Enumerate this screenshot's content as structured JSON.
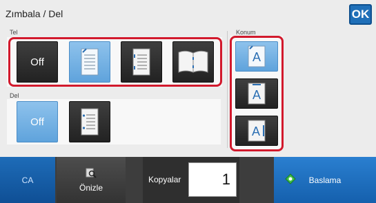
{
  "header": {
    "title": "Zımbala / Del",
    "ok_label": "OK"
  },
  "tel": {
    "label": "Tel",
    "options": [
      {
        "label": "Off",
        "selected": false
      },
      {
        "icon": "staple-one-corner-icon",
        "selected": true
      },
      {
        "icon": "staple-two-left-icon",
        "selected": false
      },
      {
        "icon": "staple-saddle-icon",
        "selected": false
      }
    ]
  },
  "del": {
    "label": "Del",
    "options": [
      {
        "label": "Off",
        "selected": true
      },
      {
        "icon": "punch-left-icon",
        "selected": false
      }
    ]
  },
  "konum": {
    "label": "Konum",
    "options": [
      {
        "glyph": "A",
        "icon": "position-left-icon",
        "selected": true
      },
      {
        "glyph": "A",
        "icon": "position-top-icon",
        "selected": false
      },
      {
        "glyph": "A",
        "icon": "position-right-icon",
        "selected": false
      }
    ]
  },
  "bottom": {
    "ca_label": "CA",
    "preview_label": "Önizle",
    "copies_label": "Kopyalar",
    "copies_value": "1",
    "start_label": "Baslama"
  },
  "colors": {
    "highlight": "#d2192c",
    "accent": "#1f6fb8",
    "selected": "#6faee4"
  }
}
